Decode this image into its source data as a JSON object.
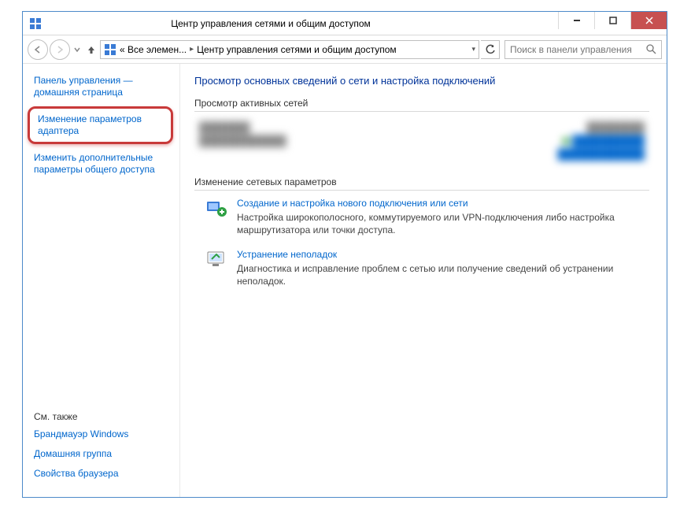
{
  "titlebar": {
    "title": "Центр управления сетями и общим доступом"
  },
  "breadcrumbs": {
    "segment1": "« Все элемен...",
    "segment2": "Центр управления сетями и общим доступом"
  },
  "search": {
    "placeholder": "Поиск в панели управления"
  },
  "sidebar": {
    "home": "Панель управления — домашняя страница",
    "adapter": "Изменение параметров адаптера",
    "advanced": "Изменить дополнительные параметры общего доступа",
    "see_also": "См. также",
    "firewall": "Брандмауэр Windows",
    "homegroup": "Домашняя группа",
    "browser": "Свойства браузера"
  },
  "main": {
    "heading": "Просмотр основных сведений о сети и настройка подключений",
    "active_label": "Просмотр активных сетей",
    "change_label": "Изменение сетевых параметров",
    "task1": {
      "title": "Создание и настройка нового подключения или сети",
      "desc": "Настройка широкополосного, коммутируемого или VPN-подключения либо настройка маршрутизатора или точки доступа."
    },
    "task2": {
      "title": "Устранение неполадок",
      "desc": "Диагностика и исправление проблем с сетью или получение сведений об устранении неполадок."
    }
  }
}
